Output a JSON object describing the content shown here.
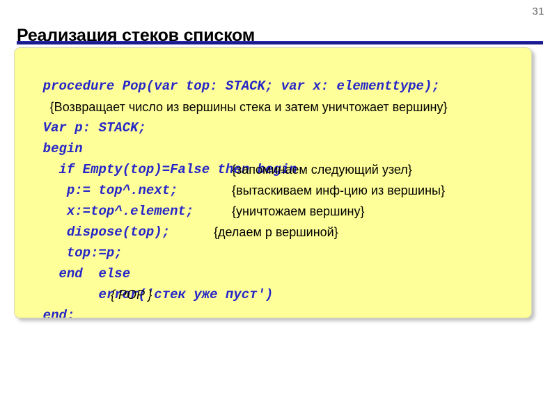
{
  "slide": {
    "number": "31",
    "title": "Реализация стеков списком",
    "rule_color": "#1a1a8c",
    "panel_bg": "#ffff99",
    "code_color": "#2626c8",
    "comment_color": "#000000"
  },
  "code": {
    "lines": [
      {
        "code": "procedure Pop(var top: STACK; var x: elementtype);",
        "comment": ""
      },
      {
        "code": "",
        "comment": "  {Возвращает число из вершины стека и затем уничтожает вершину}"
      },
      {
        "code": "Var p: STACK;",
        "comment": ""
      },
      {
        "code": "begin",
        "comment": ""
      },
      {
        "code": "  if Empty(top)=False then begin",
        "comment": ""
      },
      {
        "code": "   p:= top^.next;",
        "comment": "{запоминаем следующий узел}"
      },
      {
        "code": "   x:=top^.element;",
        "comment": "{вытаскиваем инф-цию из вершины}"
      },
      {
        "code": "   dispose(top);",
        "comment": "{уничтожаем вершину}"
      },
      {
        "code": "   top:=p;",
        "comment": "{делаем р вершиной}"
      },
      {
        "code": "  end  else",
        "comment": ""
      },
      {
        "code": "       error('стек уже пуст')",
        "comment": ""
      },
      {
        "code": "end;",
        "comment": "{ POP }"
      }
    ]
  }
}
